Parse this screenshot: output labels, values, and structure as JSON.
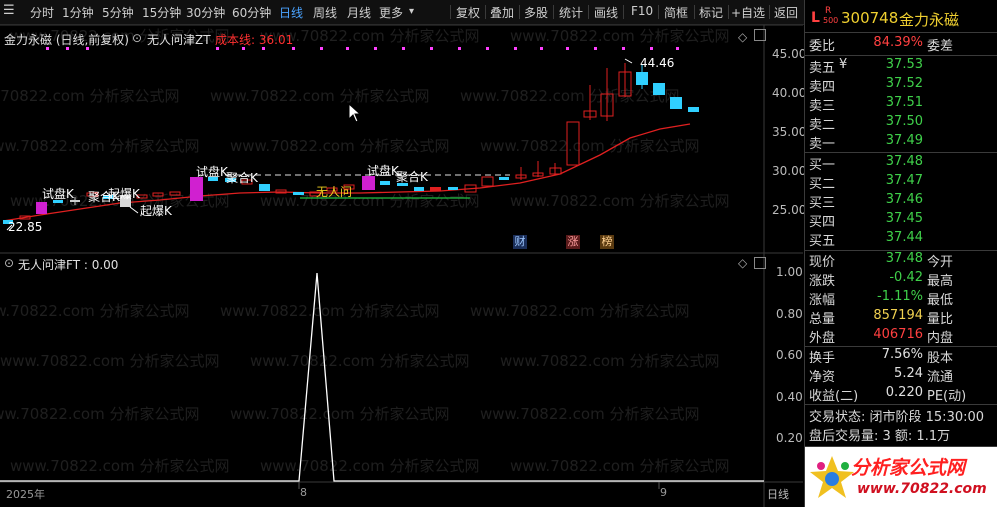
{
  "toolbar": {
    "periods": [
      "分时",
      "1分钟",
      "5分钟",
      "15分钟",
      "30分钟",
      "60分钟",
      "日线",
      "周线",
      "月线",
      "更多"
    ],
    "active_period": "日线",
    "right_buttons": [
      "复权",
      "叠加",
      "多股",
      "统计",
      "画线",
      "F10",
      "简框",
      "标记",
      "+自选",
      "返回"
    ]
  },
  "main_chart": {
    "title": "金力永磁 (日线,前复权)",
    "indicator_name": "无人问津ZT",
    "cost_label": "成本线: 36.01",
    "y_ticks": [
      "45.00",
      "40.00",
      "35.00",
      "30.00",
      "25.00"
    ],
    "annotations": {
      "high": "44.46",
      "low": "22.85",
      "shi_pan_1": "试盘K",
      "ju_he_1": "聚合K",
      "qi_bao_2": "起爆K",
      "qi_bao_1": "起爆K",
      "shi_pan_2": "试盘K",
      "ju_he_2": "聚合K",
      "shi_pan_3": "试盘K",
      "ju_he_3": "聚合K",
      "wu_ren_wen": "无人问"
    },
    "badges": [
      "财",
      "涨",
      "榜"
    ]
  },
  "sub_chart": {
    "title": "无人问津FT : 0.00",
    "y_ticks": [
      "1.00",
      "0.80",
      "0.60",
      "0.40",
      "0.20"
    ]
  },
  "time_axis": {
    "labels": [
      "2025年",
      "8",
      "9"
    ],
    "right_label": "日线"
  },
  "chart_data": {
    "type": "line",
    "title": "无人问津FT : 0.00",
    "x": [
      "2025年",
      "8",
      "9"
    ],
    "series": [
      {
        "name": "无人问津FT",
        "values": [
          0,
          0,
          0,
          1,
          0,
          0,
          0
        ]
      }
    ],
    "ylim": [
      0,
      1
    ]
  },
  "stock": {
    "code": "300748",
    "name": "金力永磁",
    "badge_top": "L",
    "badge_r": "R",
    "badge_num": "500"
  },
  "order_book": {
    "weibi_label": "委比",
    "weibi_value": "84.39%",
    "weicha_label": "委差",
    "asks": [
      {
        "label": "卖五",
        "flag": "¥",
        "price": "37.53"
      },
      {
        "label": "卖四",
        "flag": "",
        "price": "37.52"
      },
      {
        "label": "卖三",
        "flag": "",
        "price": "37.51"
      },
      {
        "label": "卖二",
        "flag": "",
        "price": "37.50"
      },
      {
        "label": "卖一",
        "flag": "",
        "price": "37.49"
      }
    ],
    "bids": [
      {
        "label": "买一",
        "price": "37.48"
      },
      {
        "label": "买二",
        "price": "37.47"
      },
      {
        "label": "买三",
        "price": "37.46"
      },
      {
        "label": "买四",
        "price": "37.45"
      },
      {
        "label": "买五",
        "price": "37.44"
      }
    ]
  },
  "quote": [
    {
      "l": "现价",
      "v": "37.48",
      "c": "dn",
      "r": "今开"
    },
    {
      "l": "涨跌",
      "v": "-0.42",
      "c": "dn",
      "r": "最高"
    },
    {
      "l": "涨幅",
      "v": "-1.11%",
      "c": "dn",
      "r": "最低"
    },
    {
      "l": "总量",
      "v": "857194",
      "c": "yl",
      "r": "量比"
    },
    {
      "l": "外盘",
      "v": "406716",
      "c": "up",
      "r": "内盘"
    }
  ],
  "quote2": [
    {
      "l": "换手",
      "v": "7.56%",
      "r": "股本"
    },
    {
      "l": "净资",
      "v": "5.24",
      "r": "流通"
    },
    {
      "l": "收益(二)",
      "v": "0.220",
      "r": "PE(动)"
    }
  ],
  "trade_status": "交易状态: 闭市阶段 15:30:00",
  "after_hours": "盘后交易量: 3  额: 1.1万",
  "logo": {
    "text": "分析家公式网",
    "url": "www.70822.com"
  },
  "watermark": "www.70822.com 分析家公式网"
}
